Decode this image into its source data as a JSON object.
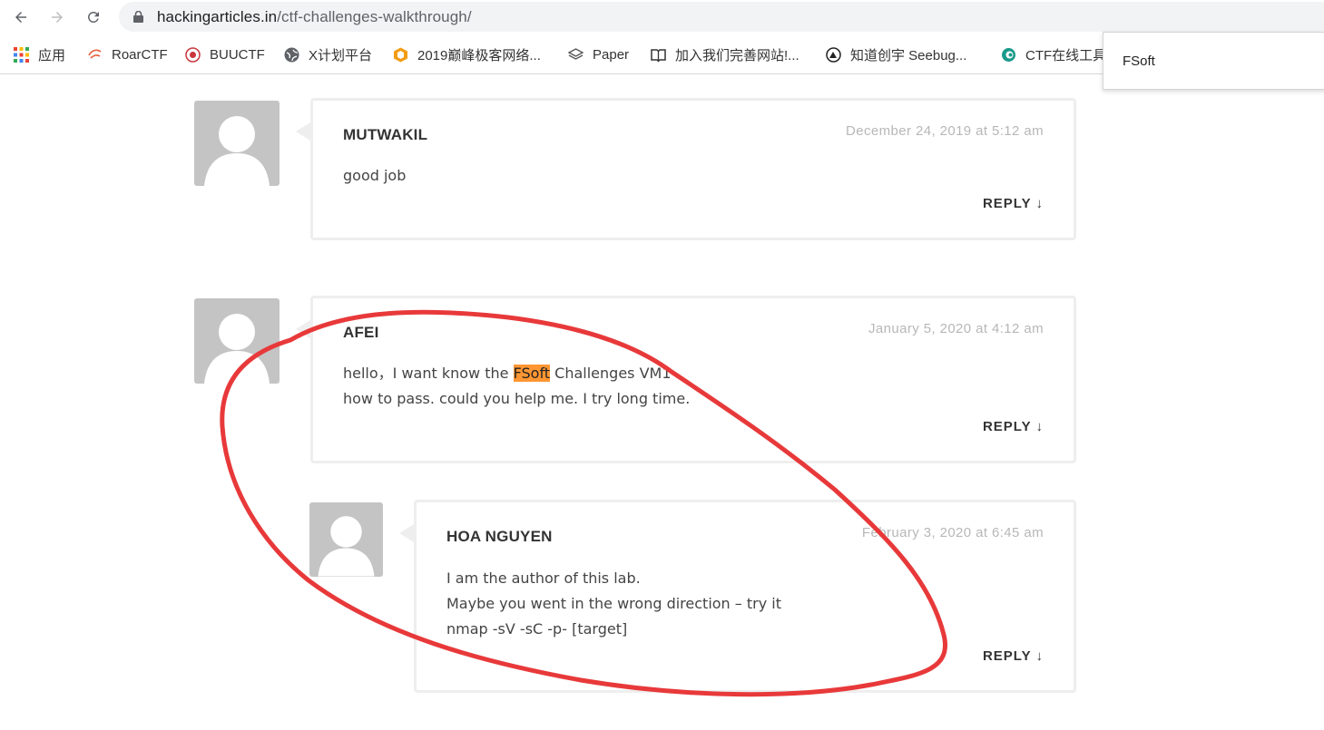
{
  "browser": {
    "url_host": "hackingarticles.in",
    "url_path": "/ctf-challenges-walkthrough/"
  },
  "bookmarks": [
    {
      "label": "应用",
      "icon": "apps-grid-icon"
    },
    {
      "label": "RoarCTF",
      "icon": "roarctf-icon"
    },
    {
      "label": "BUUCTF",
      "icon": "buuctf-icon"
    },
    {
      "label": "X计划平台",
      "icon": "globe-icon"
    },
    {
      "label": "2019巅峰极客网络...",
      "icon": "geek-icon"
    },
    {
      "label": "Paper",
      "icon": "paper-icon"
    },
    {
      "label": "加入我们完善网站!...",
      "icon": "book-icon"
    },
    {
      "label": "知道创宇 Seebug...",
      "icon": "seebug-icon"
    },
    {
      "label": "CTF在线工具",
      "icon": "ctf-tool-icon"
    }
  ],
  "find_popup": {
    "query": "FSoft"
  },
  "comments": [
    {
      "author": "MUTWAKIL",
      "date": "December 24, 2019 at 5:12 am",
      "lines": [
        "good job"
      ],
      "reply": "REPLY ↓"
    },
    {
      "author": "AFEI",
      "date": "January 5, 2020 at 4:12 am",
      "line1_before": "hello，I want know the ",
      "line1_highlight": "FSoft",
      "line1_after": " Challenges VM1",
      "line2": "how to pass. could you help me. I try long time.",
      "reply": "REPLY ↓"
    },
    {
      "author": "HOA NGUYEN",
      "date": "February 3, 2020 at 6:45 am",
      "lines": [
        "I am the author of this lab.",
        "Maybe you went in the wrong direction – try it",
        "nmap -sV -sC -p- [target]"
      ],
      "reply": "REPLY ↓"
    }
  ],
  "colors": {
    "annotation_circle": "#e8393a",
    "find_highlight": "#ff9632",
    "avatar_bg": "#c4c4c4"
  }
}
